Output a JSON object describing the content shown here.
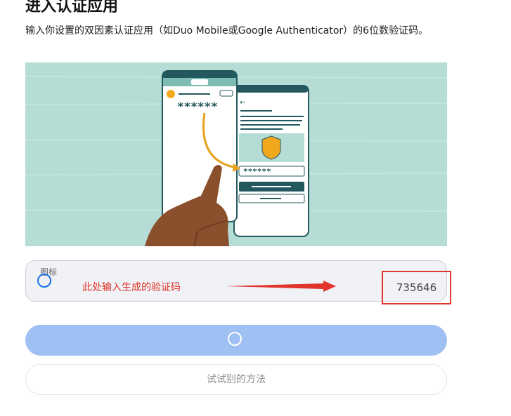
{
  "header": {
    "title": "进入认证应用",
    "description": "输入你设置的双因素认证应用（如Duo Mobile或Google Authenticator）的6位数验证码。"
  },
  "illustration": {
    "masked_code_top": "******",
    "masked_code_bottom": "******",
    "accent_color": "#f2a81d",
    "bg_color": "#b5ddd6"
  },
  "code_input": {
    "label": "图标",
    "annotation": "此处输入生成的验证码",
    "value": "735646",
    "icon": "circle-icon"
  },
  "actions": {
    "submit_icon": "spinner-icon",
    "alt_method_label": "试试别的方法"
  },
  "colors": {
    "submit_bg": "#9ec0f2",
    "annotation_red": "#e0342c"
  }
}
